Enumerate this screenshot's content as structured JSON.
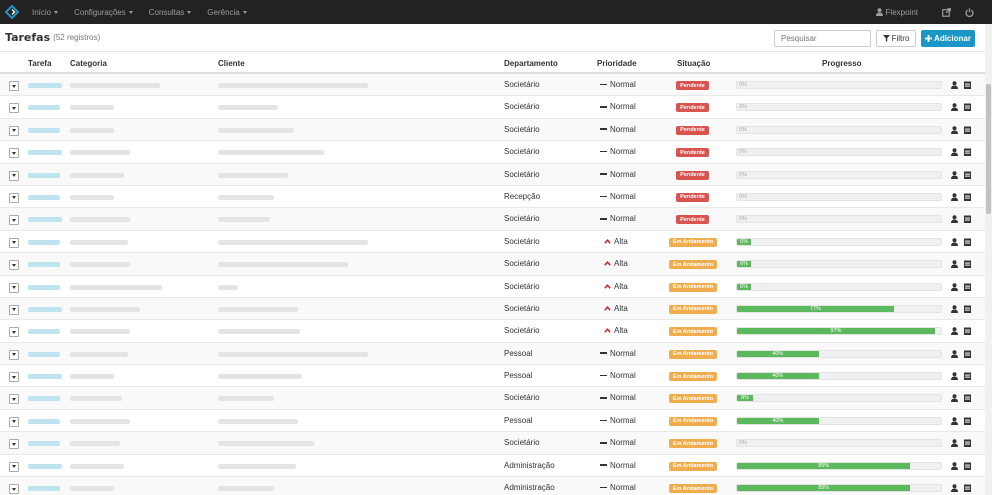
{
  "nav": {
    "items": [
      {
        "label": "Início",
        "icon": "caret-down-icon"
      },
      {
        "label": "Configurações",
        "icon": "caret-down-icon"
      },
      {
        "label": "Consultas",
        "icon": "caret-down-icon"
      },
      {
        "label": "Gerência",
        "icon": "caret-down-icon"
      }
    ],
    "user": "Flexpoint"
  },
  "header": {
    "title": "Tarefas",
    "count": "(52 registros)",
    "search_placeholder": "Pesquisar",
    "filter_label": "Filtro",
    "add_label": "Adicionar"
  },
  "table": {
    "columns": {
      "tarefa": "Tarefa",
      "categoria": "Categoria",
      "cliente": "Cliente",
      "departamento": "Departamento",
      "prioridade": "Prioridade",
      "situacao": "Situação",
      "progresso": "Progresso"
    },
    "rows": [
      {
        "departamento": "Societário",
        "prioridade": "Normal",
        "situacao": "Pendente",
        "progresso": 0,
        "progresso_label": "0%"
      },
      {
        "departamento": "Societário",
        "prioridade": "Normal",
        "situacao": "Pendente",
        "progresso": 0,
        "progresso_label": "0%"
      },
      {
        "departamento": "Societário",
        "prioridade": "Normal",
        "situacao": "Pendente",
        "progresso": 0,
        "progresso_label": "0%"
      },
      {
        "departamento": "Societário",
        "prioridade": "Normal",
        "situacao": "Pendente",
        "progresso": 0,
        "progresso_label": "0%"
      },
      {
        "departamento": "Societário",
        "prioridade": "Normal",
        "situacao": "Pendente",
        "progresso": 0,
        "progresso_label": "0%"
      },
      {
        "departamento": "Recepção",
        "prioridade": "Normal",
        "situacao": "Pendente",
        "progresso": 0,
        "progresso_label": "0%"
      },
      {
        "departamento": "Societário",
        "prioridade": "Normal",
        "situacao": "Pendente",
        "progresso": 0,
        "progresso_label": "0%"
      },
      {
        "departamento": "Societário",
        "prioridade": "Alta",
        "situacao": "Em Andamento",
        "progresso": 6,
        "progresso_label": "6%"
      },
      {
        "departamento": "Societário",
        "prioridade": "Alta",
        "situacao": "Em Andamento",
        "progresso": 6,
        "progresso_label": "6%"
      },
      {
        "departamento": "Societário",
        "prioridade": "Alta",
        "situacao": "Em Andamento",
        "progresso": 6,
        "progresso_label": "6%"
      },
      {
        "departamento": "Societário",
        "prioridade": "Alta",
        "situacao": "Em Andamento",
        "progresso": 77,
        "progresso_label": "77%"
      },
      {
        "departamento": "Societário",
        "prioridade": "Alta",
        "situacao": "Em Andamento",
        "progresso": 97,
        "progresso_label": "97%"
      },
      {
        "departamento": "Pessoal",
        "prioridade": "Normal",
        "situacao": "Em Andamento",
        "progresso": 40,
        "progresso_label": "40%"
      },
      {
        "departamento": "Pessoal",
        "prioridade": "Normal",
        "situacao": "Em Andamento",
        "progresso": 40,
        "progresso_label": "40%"
      },
      {
        "departamento": "Societário",
        "prioridade": "Normal",
        "situacao": "Em Andamento",
        "progresso": 8,
        "progresso_label": "8%"
      },
      {
        "departamento": "Pessoal",
        "prioridade": "Normal",
        "situacao": "Em Andamento",
        "progresso": 40,
        "progresso_label": "40%"
      },
      {
        "departamento": "Societário",
        "prioridade": "Normal",
        "situacao": "Em Andamento",
        "progresso": 0,
        "progresso_label": "0%"
      },
      {
        "departamento": "Administração",
        "prioridade": "Normal",
        "situacao": "Em Andamento",
        "progresso": 85,
        "progresso_label": "85%"
      },
      {
        "departamento": "Administração",
        "prioridade": "Normal",
        "situacao": "Em Andamento",
        "progresso": 85,
        "progresso_label": "85%"
      }
    ]
  },
  "colors": {
    "navbar": "#222222",
    "accent": "#1a97c6",
    "pendente": "#d9534f",
    "andamento": "#f0ad4e",
    "progress": "#5cb85c",
    "alta": "#c9302c"
  },
  "icons": {
    "logo": "logo-icon",
    "user": "user-icon",
    "external": "external-link-icon",
    "power": "power-icon",
    "filter": "filter-icon",
    "add": "plus-icon",
    "row_user": "user-icon",
    "row_calendar": "calendar-icon"
  }
}
